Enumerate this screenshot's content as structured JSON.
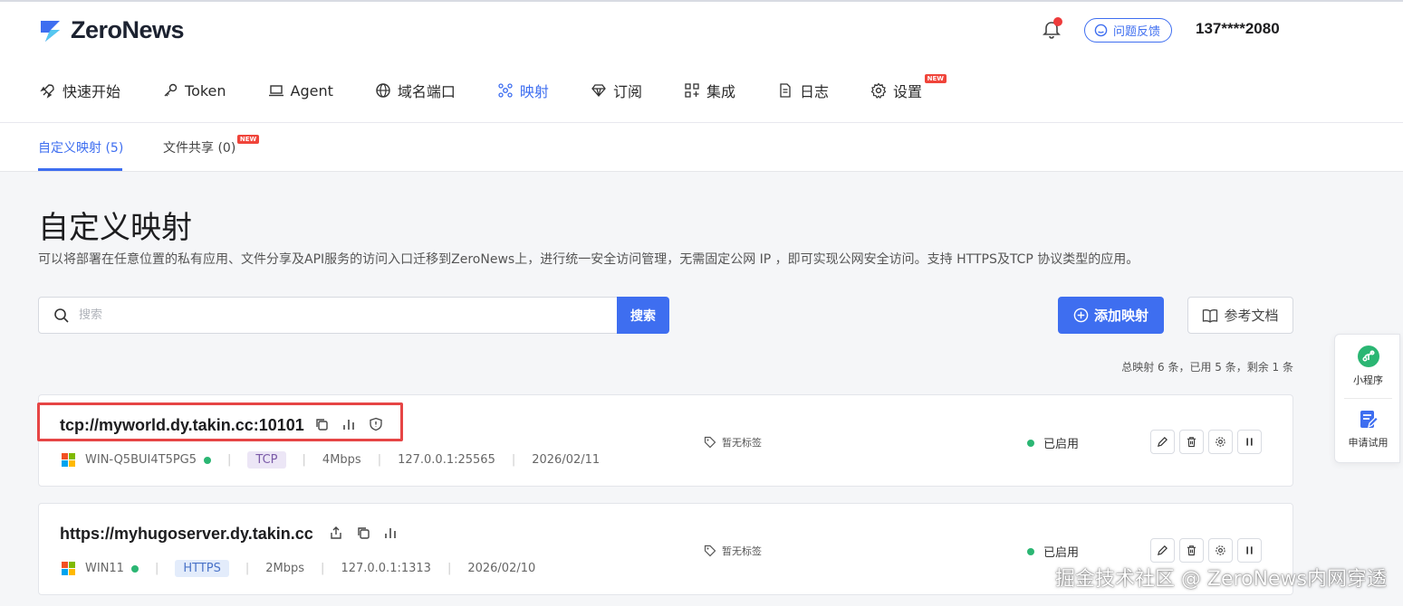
{
  "app": {
    "logo_text": "ZeroNews",
    "feedback_label": "问题反馈",
    "user": "137****2080",
    "accent_color": "#3e6ef0"
  },
  "nav": {
    "items": [
      {
        "label": "快速开始",
        "icon": "rocket-icon",
        "active": false
      },
      {
        "label": "Token",
        "icon": "key-icon",
        "active": false
      },
      {
        "label": "Agent",
        "icon": "laptop-icon",
        "active": false
      },
      {
        "label": "域名端口",
        "icon": "globe-icon",
        "active": false
      },
      {
        "label": "映射",
        "icon": "network-icon",
        "active": true
      },
      {
        "label": "订阅",
        "icon": "diamond-icon",
        "active": false
      },
      {
        "label": "集成",
        "icon": "apps-icon",
        "active": false
      },
      {
        "label": "日志",
        "icon": "file-icon",
        "active": false
      },
      {
        "label": "设置",
        "icon": "gear-icon",
        "active": false,
        "badge": "NEW"
      }
    ]
  },
  "tabs": [
    {
      "label": "自定义映射 (5)",
      "active": true
    },
    {
      "label": "文件共享 (0)",
      "active": false,
      "badge": "NEW"
    }
  ],
  "page": {
    "title": "自定义映射",
    "description": "可以将部署在任意位置的私有应用、文件分享及API服务的访问入口迁移到ZeroNews上，进行统一安全访问管理，无需固定公网 IP ，即可实现公网安全访问。支持 HTTPS及TCP 协议类型的应用。"
  },
  "search": {
    "placeholder": "搜索",
    "value": "",
    "button": "搜索"
  },
  "actions": {
    "add": "添加映射",
    "docs": "参考文档"
  },
  "summary": "总映射 6 条，已用 5 条，剩余 1 条",
  "mappings": [
    {
      "url": "tcp://myworld.dy.takin.cc:10101",
      "agent": "WIN-Q5BUI4T5PG5",
      "protocol": "TCP",
      "bandwidth": "4Mbps",
      "target": "127.0.0.1:25565",
      "date": "2026/02/11",
      "tag": "暂无标签",
      "status": "已启用"
    },
    {
      "url": "https://myhugoserver.dy.takin.cc",
      "agent": "WIN11",
      "protocol": "HTTPS",
      "bandwidth": "2Mbps",
      "target": "127.0.0.1:1313",
      "date": "2026/02/10",
      "tag": "暂无标签",
      "status": "已启用"
    }
  ],
  "floating": {
    "mini_program": "小程序",
    "trial": "申请试用"
  },
  "watermark": "掘金技术社区 @ ZeroNews内网穿透"
}
